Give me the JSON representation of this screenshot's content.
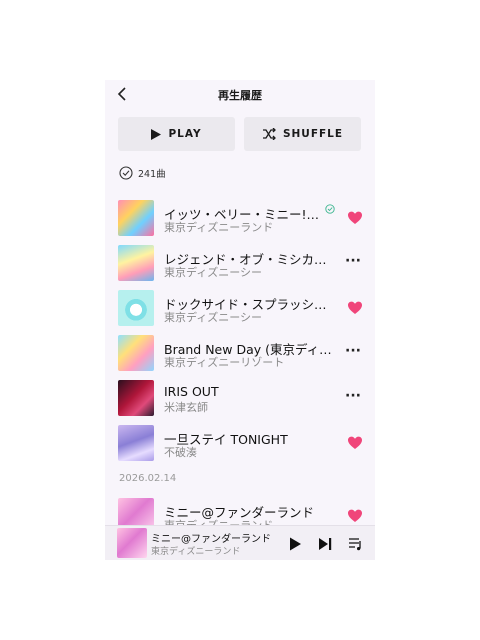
{
  "header": {
    "title": "再生履歴"
  },
  "actions": {
    "play_label": "PLAY",
    "shuffle_label": "SHUFFLE"
  },
  "count": {
    "label": "241曲"
  },
  "tracks": [
    {
      "title": "イッツ・ベリー・ミニー!…",
      "artist": "東京ディズニーランド",
      "liked": true,
      "verified": true
    },
    {
      "title": "レジェンド・オブ・ミシカ…",
      "artist": "東京ディズニーシー",
      "liked": false
    },
    {
      "title": "ドックサイド・スプラッシ…",
      "artist": "東京ディズニーシー",
      "liked": true
    },
    {
      "title": "Brand New Day (東京ディ…",
      "artist": "東京ディズニーリゾート",
      "liked": false
    },
    {
      "title": "IRIS OUT",
      "artist": "米津玄師",
      "liked": false
    },
    {
      "title": "一旦ステイ TONIGHT",
      "artist": "不破湊",
      "liked": true
    }
  ],
  "section_date": "2026.02.14",
  "next_track": {
    "title": "ミニー@ファンダーランド",
    "artist": "東京ディズニーランド",
    "liked": true
  },
  "now_playing": {
    "title": "ミニー@ファンダーランド",
    "artist": "東京ディズニーランド"
  },
  "colors": {
    "heart": "#f0457a",
    "verified": "#3bb58f",
    "background": "#f8f5fb"
  },
  "icons": [
    "chevron-left-icon",
    "play-icon",
    "shuffle-icon",
    "check-circle-icon",
    "heart-icon",
    "more-icon",
    "next-icon",
    "queue-icon"
  ]
}
